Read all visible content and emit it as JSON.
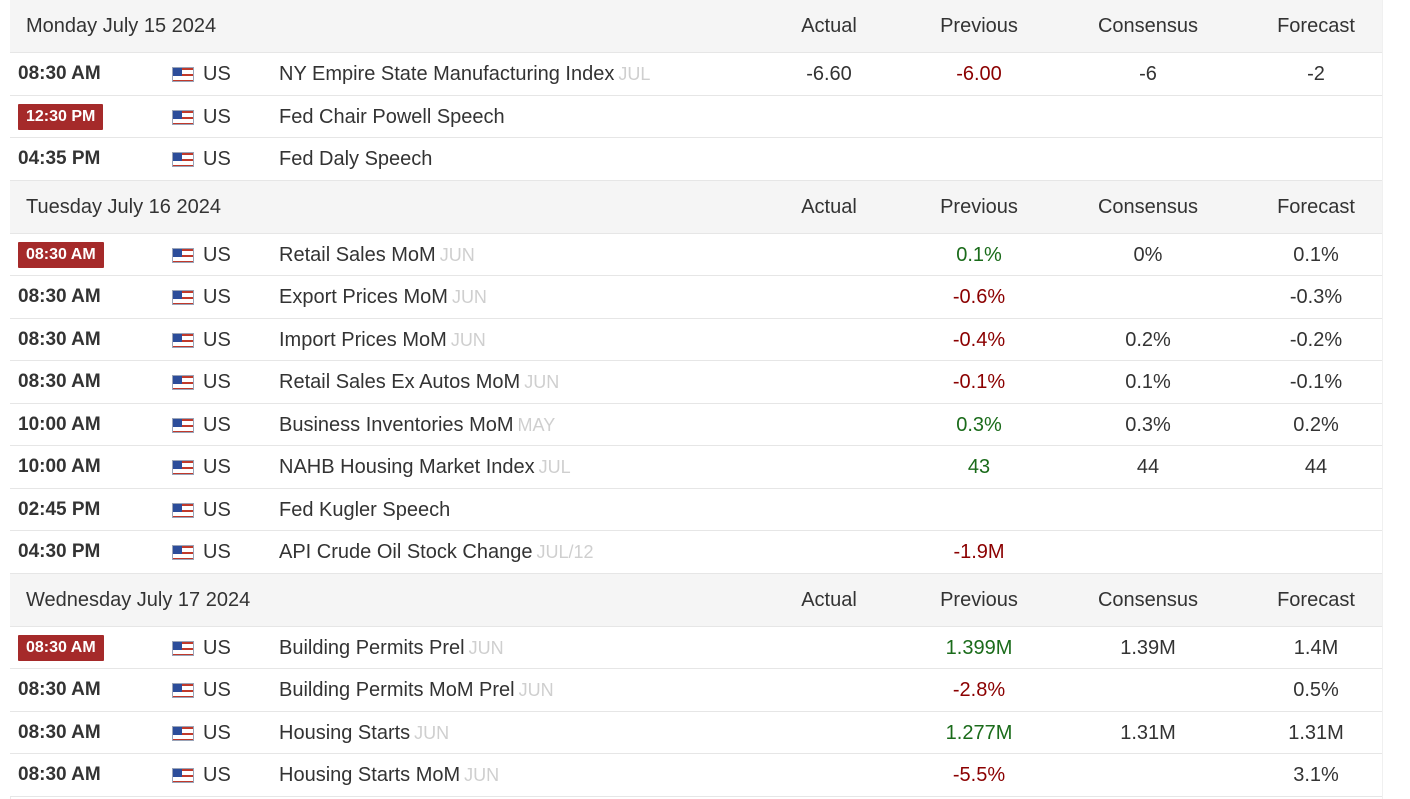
{
  "columns": {
    "actual": "Actual",
    "previous": "Previous",
    "consensus": "Consensus",
    "forecast": "Forecast"
  },
  "days": [
    {
      "title": "Monday July 15 2024",
      "rows": [
        {
          "time": "08:30 AM",
          "highlight": false,
          "country": "US",
          "event": "NY Empire State Manufacturing Index",
          "ref": "JUL",
          "actual": "-6.60",
          "previous": "-6.00",
          "previous_tone": "neg",
          "consensus": "-6",
          "forecast": "-2"
        },
        {
          "time": "12:30 PM",
          "highlight": true,
          "country": "US",
          "event": "Fed Chair Powell Speech",
          "ref": "",
          "actual": "",
          "previous": "",
          "previous_tone": "",
          "consensus": "",
          "forecast": ""
        },
        {
          "time": "04:35 PM",
          "highlight": false,
          "country": "US",
          "event": "Fed Daly Speech",
          "ref": "",
          "actual": "",
          "previous": "",
          "previous_tone": "",
          "consensus": "",
          "forecast": ""
        }
      ]
    },
    {
      "title": "Tuesday July 16 2024",
      "rows": [
        {
          "time": "08:30 AM",
          "highlight": true,
          "country": "US",
          "event": "Retail Sales MoM",
          "ref": "JUN",
          "actual": "",
          "previous": "0.1%",
          "previous_tone": "pos",
          "consensus": "0%",
          "forecast": "0.1%"
        },
        {
          "time": "08:30 AM",
          "highlight": false,
          "country": "US",
          "event": "Export Prices MoM",
          "ref": "JUN",
          "actual": "",
          "previous": "-0.6%",
          "previous_tone": "neg",
          "consensus": "",
          "forecast": "-0.3%"
        },
        {
          "time": "08:30 AM",
          "highlight": false,
          "country": "US",
          "event": "Import Prices MoM",
          "ref": "JUN",
          "actual": "",
          "previous": "-0.4%",
          "previous_tone": "neg",
          "consensus": "0.2%",
          "forecast": "-0.2%"
        },
        {
          "time": "08:30 AM",
          "highlight": false,
          "country": "US",
          "event": "Retail Sales Ex Autos MoM",
          "ref": "JUN",
          "actual": "",
          "previous": "-0.1%",
          "previous_tone": "neg",
          "consensus": "0.1%",
          "forecast": "-0.1%"
        },
        {
          "time": "10:00 AM",
          "highlight": false,
          "country": "US",
          "event": "Business Inventories MoM",
          "ref": "MAY",
          "actual": "",
          "previous": "0.3%",
          "previous_tone": "pos",
          "consensus": "0.3%",
          "forecast": "0.2%"
        },
        {
          "time": "10:00 AM",
          "highlight": false,
          "country": "US",
          "event": "NAHB Housing Market Index",
          "ref": "JUL",
          "actual": "",
          "previous": "43",
          "previous_tone": "pos",
          "consensus": "44",
          "forecast": "44"
        },
        {
          "time": "02:45 PM",
          "highlight": false,
          "country": "US",
          "event": "Fed Kugler Speech",
          "ref": "",
          "actual": "",
          "previous": "",
          "previous_tone": "",
          "consensus": "",
          "forecast": ""
        },
        {
          "time": "04:30 PM",
          "highlight": false,
          "country": "US",
          "event": "API Crude Oil Stock Change",
          "ref": "JUL/12",
          "actual": "",
          "previous": "-1.9M",
          "previous_tone": "neg",
          "consensus": "",
          "forecast": ""
        }
      ]
    },
    {
      "title": "Wednesday July 17 2024",
      "rows": [
        {
          "time": "08:30 AM",
          "highlight": true,
          "country": "US",
          "event": "Building Permits Prel",
          "ref": "JUN",
          "actual": "",
          "previous": "1.399M",
          "previous_tone": "pos",
          "consensus": "1.39M",
          "forecast": "1.4M"
        },
        {
          "time": "08:30 AM",
          "highlight": false,
          "country": "US",
          "event": "Building Permits MoM Prel",
          "ref": "JUN",
          "actual": "",
          "previous": "-2.8%",
          "previous_tone": "neg",
          "consensus": "",
          "forecast": "0.5%"
        },
        {
          "time": "08:30 AM",
          "highlight": false,
          "country": "US",
          "event": "Housing Starts",
          "ref": "JUN",
          "actual": "",
          "previous": "1.277M",
          "previous_tone": "pos",
          "consensus": "1.31M",
          "forecast": "1.31M"
        },
        {
          "time": "08:30 AM",
          "highlight": false,
          "country": "US",
          "event": "Housing Starts MoM",
          "ref": "JUN",
          "actual": "",
          "previous": "-5.5%",
          "previous_tone": "neg",
          "consensus": "",
          "forecast": "3.1%"
        }
      ]
    }
  ]
}
